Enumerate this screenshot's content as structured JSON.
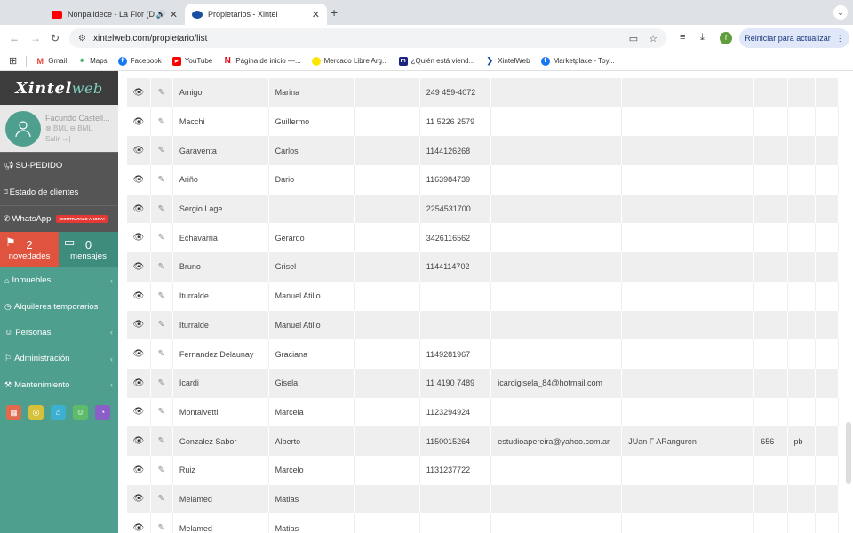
{
  "browser": {
    "tabs": [
      {
        "title": "Nonpalidece - La Flor (DVD",
        "favicon_color": "#ff0000"
      },
      {
        "title": "Propietarios - Xintel",
        "favicon_color": "#1a4fa0"
      }
    ],
    "url": "xintelweb.com/propietario/list",
    "profile_initial": "f",
    "update_label": "Reiniciar para actualizar"
  },
  "bookmarks": [
    {
      "label": "Gmail",
      "icon": "gmail-icon",
      "color": "#ea4335"
    },
    {
      "label": "Maps",
      "icon": "maps-icon",
      "color": "#34a853"
    },
    {
      "label": "Facebook",
      "icon": "facebook-icon",
      "color": "#1877f2"
    },
    {
      "label": "YouTube",
      "icon": "youtube-icon",
      "color": "#ff0000"
    },
    {
      "label": "Página de inicio —...",
      "icon": "netflix-icon",
      "color": "#e50914"
    },
    {
      "label": "Mercado Libre Arg...",
      "icon": "mercadolibre-icon",
      "color": "#ffe600"
    },
    {
      "label": "¿Quién está viend...",
      "icon": "m-icon",
      "color": "#1a237e"
    },
    {
      "label": "XintelWeb",
      "icon": "xintel-icon",
      "color": "#1a4fa0"
    },
    {
      "label": "Marketplace - Toy...",
      "icon": "facebook-icon",
      "color": "#1877f2"
    }
  ],
  "sidebar": {
    "logo_main": "Xintel",
    "logo_accent": "web",
    "user": {
      "name": "Facundo Castell...",
      "sub1": "BML",
      "sub2": "BML",
      "logout": "Salir"
    },
    "su_pedido": "SU-PEDIDO",
    "estado_clientes": "Estado de clientes",
    "whatsapp": "WhatsApp",
    "whatsapp_badge": "¡CONTRATALO AHORA!",
    "novedades_count": "2",
    "novedades_label": "novedades",
    "mensajes_count": "0",
    "mensajes_label": "mensajes",
    "nav": [
      {
        "label": "Inmuebles",
        "icon": "home-icon",
        "chevron": true
      },
      {
        "label": "Alquileres temporarios",
        "icon": "clock-icon",
        "chevron": false
      },
      {
        "label": "Personas",
        "icon": "people-icon",
        "chevron": true
      },
      {
        "label": "Administración",
        "icon": "flag-icon",
        "chevron": true
      },
      {
        "label": "Mantenimiento",
        "icon": "wrench-icon",
        "chevron": true
      }
    ],
    "shortcuts": [
      {
        "icon": "calendar-icon",
        "color": "#e06a4e"
      },
      {
        "icon": "money-icon",
        "color": "#d8c13a"
      },
      {
        "icon": "house-icon",
        "color": "#3bb0d0"
      },
      {
        "icon": "user-icon",
        "color": "#5dbb6a"
      },
      {
        "icon": "chart-icon",
        "color": "#8a5fc8"
      }
    ]
  },
  "table": {
    "rows": [
      {
        "apellido": "Amigo",
        "nombre": "Marina",
        "telefono": "249 459-4072",
        "email": "",
        "calle": "",
        "numero": "",
        "piso": ""
      },
      {
        "apellido": "Macchi",
        "nombre": "Guillermo",
        "telefono": "11 5226 2579",
        "email": "",
        "calle": "",
        "numero": "",
        "piso": ""
      },
      {
        "apellido": "Garaventa",
        "nombre": "Carlos",
        "telefono": "1144126268",
        "email": "",
        "calle": "",
        "numero": "",
        "piso": ""
      },
      {
        "apellido": "Ariño",
        "nombre": "Dario",
        "telefono": "1163984739",
        "email": "",
        "calle": "",
        "numero": "",
        "piso": ""
      },
      {
        "apellido": "Sergio Lage",
        "nombre": "",
        "telefono": "2254531700",
        "email": "",
        "calle": "",
        "numero": "",
        "piso": ""
      },
      {
        "apellido": "Echavarria",
        "nombre": "Gerardo",
        "telefono": "3426116562",
        "email": "",
        "calle": "",
        "numero": "",
        "piso": ""
      },
      {
        "apellido": "Bruno",
        "nombre": "Grisel",
        "telefono": "1144114702",
        "email": "",
        "calle": "",
        "numero": "",
        "piso": ""
      },
      {
        "apellido": "Iturralde",
        "nombre": "Manuel Atilio",
        "telefono": "",
        "email": "",
        "calle": "",
        "numero": "",
        "piso": ""
      },
      {
        "apellido": "Iturralde",
        "nombre": "Manuel Atilio",
        "telefono": "",
        "email": "",
        "calle": "",
        "numero": "",
        "piso": ""
      },
      {
        "apellido": "Fernandez Delaunay",
        "nombre": "Graciana",
        "telefono": "1149281967",
        "email": "",
        "calle": "",
        "numero": "",
        "piso": ""
      },
      {
        "apellido": "Icardi",
        "nombre": "Gisela",
        "telefono": "11 4190 7489",
        "email": "icardigisela_84@hotmail.com",
        "calle": "",
        "numero": "",
        "piso": ""
      },
      {
        "apellido": "Montalvetti",
        "nombre": "Marcela",
        "telefono": "1123294924",
        "email": "",
        "calle": "",
        "numero": "",
        "piso": ""
      },
      {
        "apellido": "Gonzalez Sabor",
        "nombre": "Alberto",
        "telefono": "1150015264",
        "email": "estudioapereira@yahoo.com.ar",
        "calle": "JUan F ARanguren",
        "numero": "656",
        "piso": "pb"
      },
      {
        "apellido": "Ruiz",
        "nombre": "Marcelo",
        "telefono": "1131237722",
        "email": "",
        "calle": "",
        "numero": "",
        "piso": ""
      },
      {
        "apellido": "Melamed",
        "nombre": "Matias",
        "telefono": "",
        "email": "",
        "calle": "",
        "numero": "",
        "piso": ""
      },
      {
        "apellido": "Melamed",
        "nombre": "Matias",
        "telefono": "",
        "email": "",
        "calle": "",
        "numero": "",
        "piso": ""
      }
    ]
  }
}
